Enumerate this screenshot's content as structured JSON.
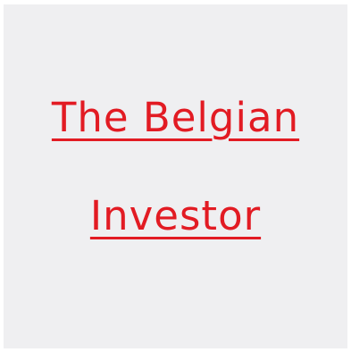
{
  "logo": {
    "line1": "The Belgian",
    "line2": "Investor",
    "text_color": "#e21b23",
    "background_color": "#efeff1"
  }
}
